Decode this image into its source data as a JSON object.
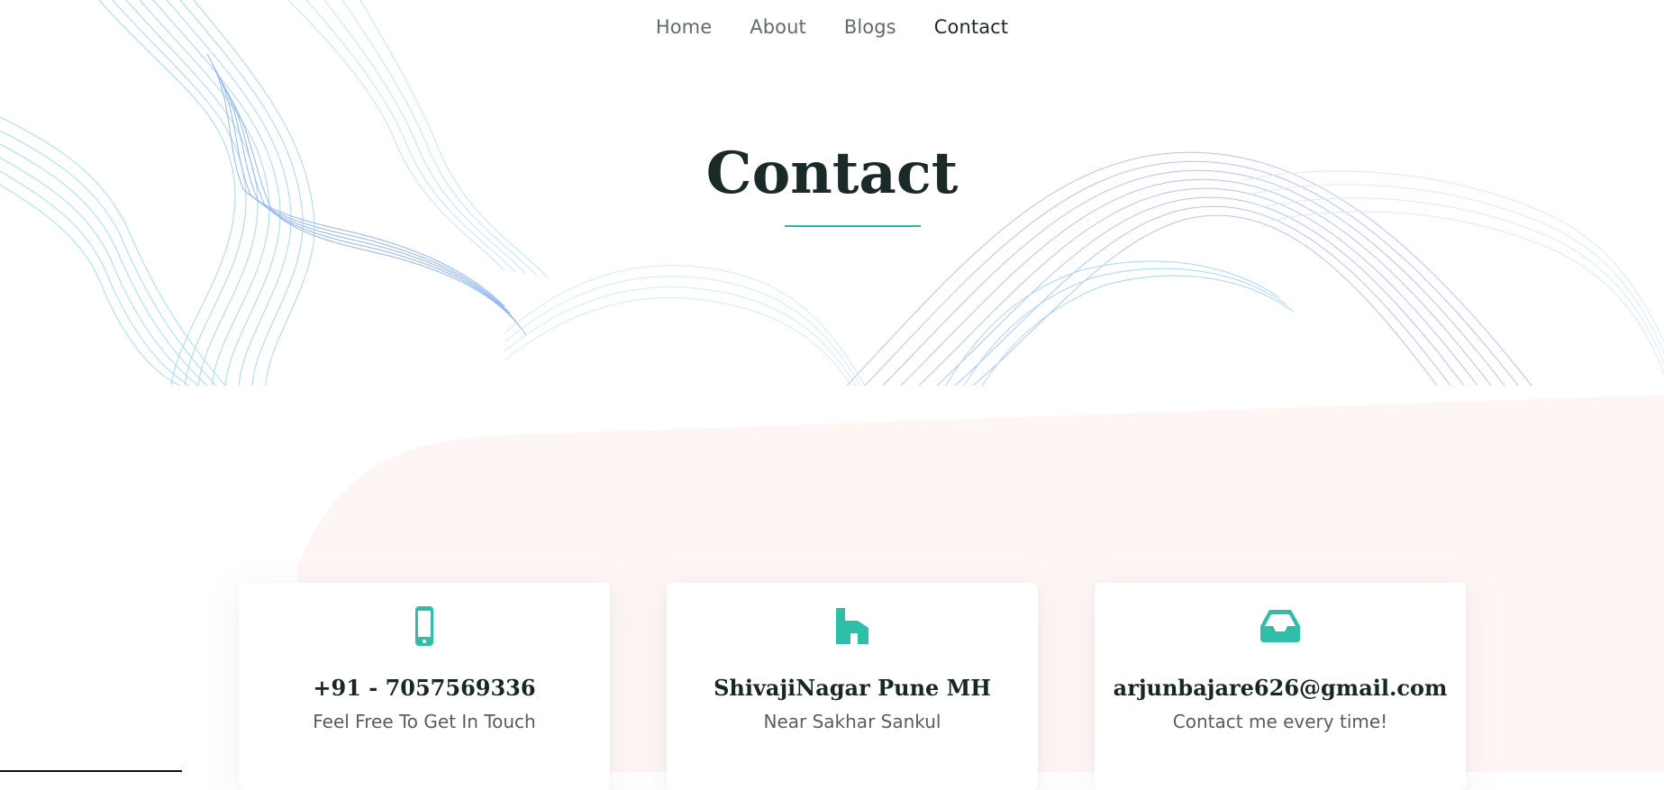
{
  "nav": {
    "items": [
      {
        "label": "Home",
        "active": false
      },
      {
        "label": "About",
        "active": false
      },
      {
        "label": "Blogs",
        "active": false
      },
      {
        "label": "Contact",
        "active": true
      }
    ]
  },
  "hero": {
    "title": "Contact"
  },
  "cards": [
    {
      "icon": "mobile-phone-icon",
      "heading": "+91 - 7057569336",
      "sub": "Feel Free To Get In Touch"
    },
    {
      "icon": "house-icon",
      "heading": "ShivajiNagar Pune MH",
      "sub": "Near Sakhar Sankul"
    },
    {
      "icon": "inbox-icon",
      "heading": "arjunbajare626@gmail.com",
      "sub": "Contact me every time!"
    }
  ],
  "colors": {
    "accent": "#2fb8a0",
    "title": "#1a2a28",
    "nav_text": "#5f6b6e",
    "nav_active": "#1d2a2c",
    "wave_blue": "#3a7be8",
    "wave_cyan": "#55c6f0"
  }
}
